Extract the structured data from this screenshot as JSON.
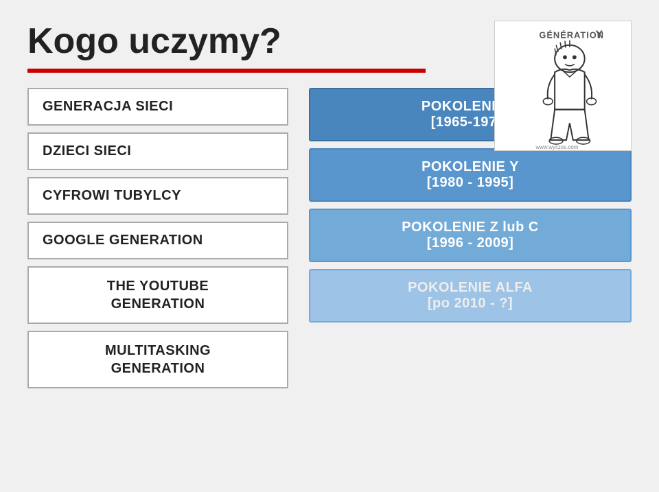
{
  "title": "Kogo uczymy?",
  "redline": true,
  "left_items": [
    {
      "id": "generacja-sieci",
      "label": "GENERACJA SIECI"
    },
    {
      "id": "dzieci-sieci",
      "label": "DZIECI SIECI"
    },
    {
      "id": "cyfrowi-tubylcy",
      "label": "CYFROWI TUBYLCY"
    },
    {
      "id": "google-generation",
      "label": "GOOGLE GENERATION"
    },
    {
      "id": "youtube-generation",
      "label": "THE YOUTUBE GENERATION",
      "two_line": true
    },
    {
      "id": "multitasking-generation",
      "label": "MULTITASKING GENERATION",
      "two_line": true
    }
  ],
  "right_items": [
    {
      "id": "pokolenie-x",
      "label": "POKOLENIE  X\n[1965-1979]",
      "style": "darkest"
    },
    {
      "id": "pokolenie-y",
      "label": "POKOLENIE Y\n[1980 - 1995]",
      "style": "dark"
    },
    {
      "id": "pokolenie-z",
      "label": "POKOLENIE Z lub C\n[1996 - 2009]",
      "style": "medium"
    },
    {
      "id": "pokolenie-alfa",
      "label": "POKOLENIE ALFA\n[po 2010 - ?]",
      "style": "light"
    }
  ],
  "image_label": "GÉNÉRATION Y"
}
